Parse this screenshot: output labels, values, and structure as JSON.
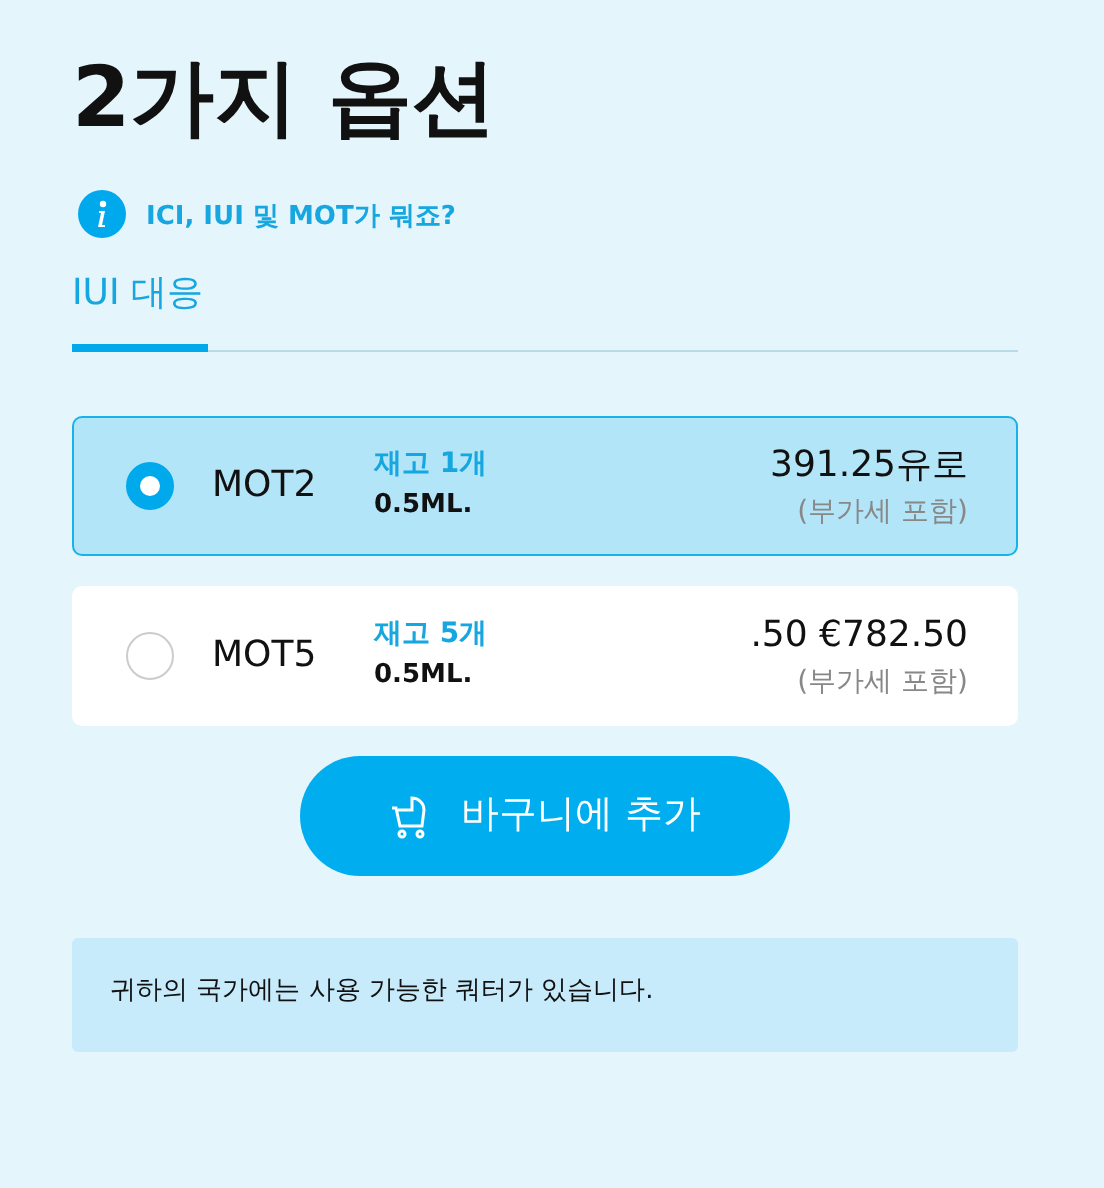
{
  "title": "2가지 옵션",
  "info_link": "ICI, IUI 및 MOT가 뭐죠?",
  "tabs": [
    {
      "label": "IUI 대응",
      "selected": true
    }
  ],
  "options": [
    {
      "name": "MOT2",
      "stock": "재고 1개",
      "volume": "0.5ML.",
      "price": "391.25유로",
      "vat": "(부가세 포함)",
      "selected": true
    },
    {
      "name": "MOT5",
      "stock": "재고 5개",
      "volume": "0.5ML.",
      "price": ".50 €782.50",
      "vat": "(부가세 포함)",
      "selected": false
    }
  ],
  "add_button": "바구니에 추가",
  "notice": "귀하의 국가에는 사용 가능한 쿼터가 있습니다."
}
